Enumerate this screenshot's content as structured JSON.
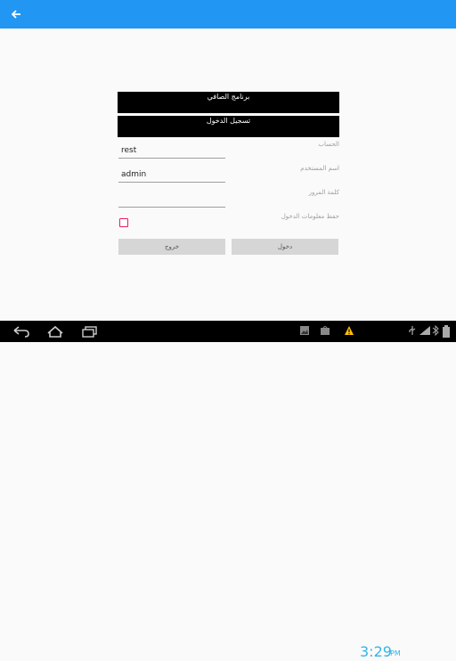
{
  "app_bar": {
    "back_icon": "arrow-left-icon",
    "color": "#2196f3"
  },
  "header": {
    "title": "برنامج الصافي",
    "subtitle": "تسجيل الدخول"
  },
  "form": {
    "account_label": "الحساب",
    "account_value": "rest",
    "username_label": "اسم المستخدم",
    "username_value": "admin",
    "password_label": "كلمة المرور",
    "password_value": "",
    "remember_label": "حفظ معلومات الدخول",
    "remember_checked": false
  },
  "buttons": {
    "exit_label": "خروج",
    "login_label": "دخول"
  },
  "system_bar": {
    "time": "3:29",
    "ampm": "PM",
    "icons": [
      "back-icon",
      "home-icon",
      "recents-icon",
      "gallery-icon",
      "store-icon",
      "warning-icon",
      "usb-icon",
      "signal-icon",
      "bluetooth-icon",
      "battery-icon"
    ]
  }
}
